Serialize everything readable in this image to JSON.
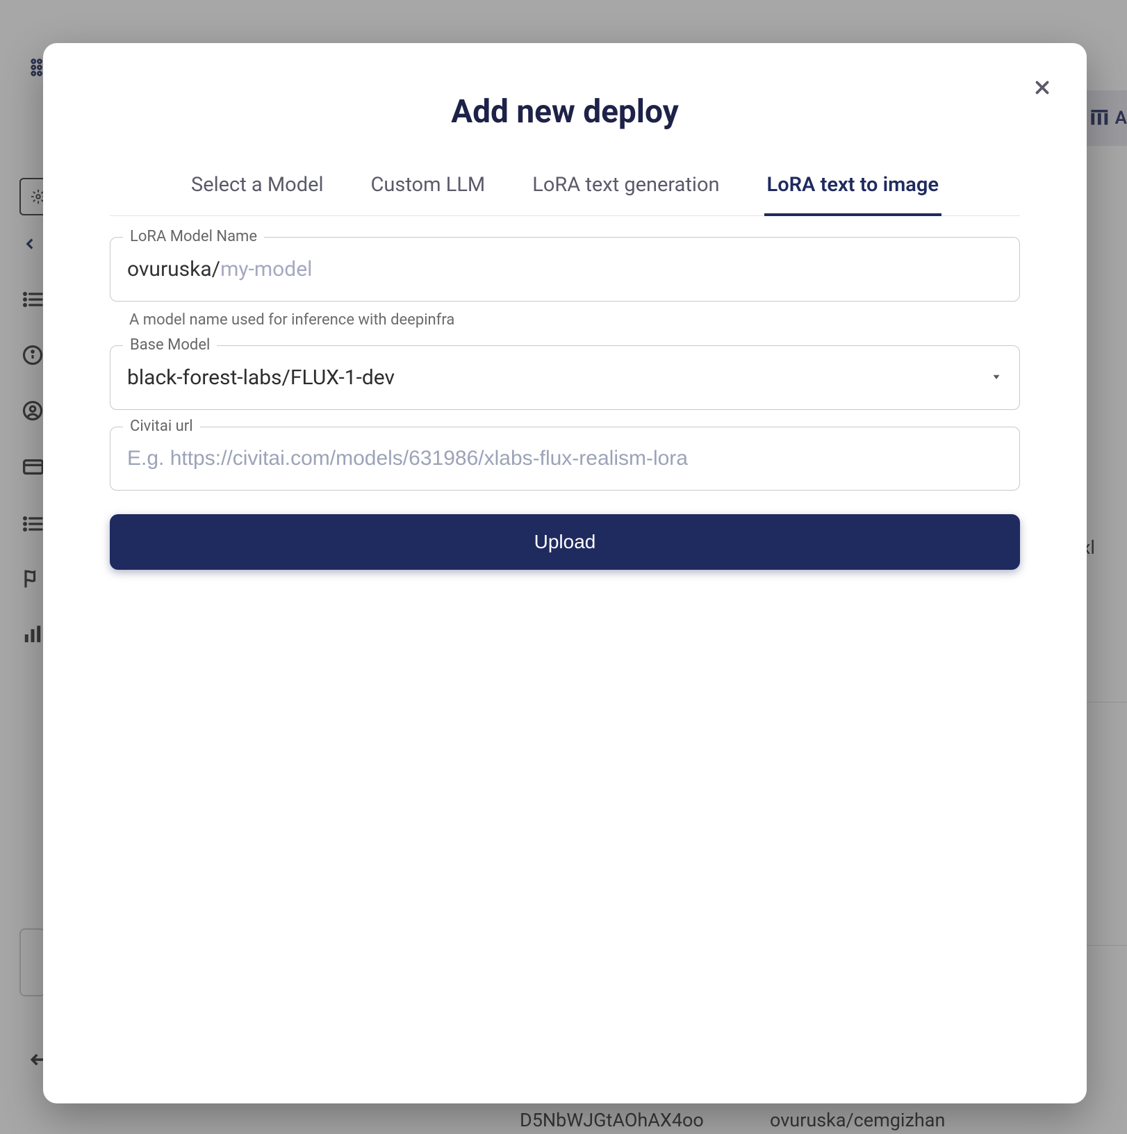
{
  "bg": {
    "right_stub_letter": "A",
    "table": {
      "row1_col1_partial": "xl",
      "row2_col1": "D5NbWJGtAOhAX4oo",
      "row2_col2": "ovuruska/cemgizhan"
    }
  },
  "modal": {
    "title": "Add new deploy",
    "tabs": [
      {
        "label": "Select a Model",
        "active": false
      },
      {
        "label": "Custom LLM",
        "active": false
      },
      {
        "label": "LoRA text generation",
        "active": false
      },
      {
        "label": "LoRA text to image",
        "active": true
      }
    ],
    "fields": {
      "model_name": {
        "legend": "LoRA Model Name",
        "prefix": "ovuruska/",
        "placeholder": "my-model",
        "value": "",
        "helper": "A model name used for inference with deepinfra"
      },
      "base_model": {
        "legend": "Base Model",
        "value": "black-forest-labs/FLUX-1-dev"
      },
      "civitai": {
        "legend": "Civitai url",
        "placeholder": "E.g. https://civitai.com/models/631986/xlabs-flux-realism-lora",
        "value": ""
      }
    },
    "upload_label": "Upload"
  }
}
